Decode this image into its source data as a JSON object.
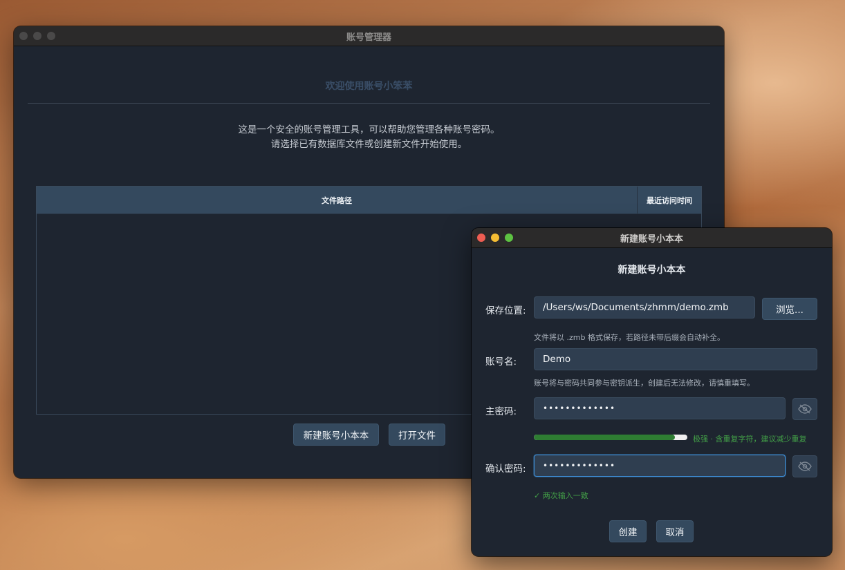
{
  "main_window": {
    "title": "账号管理器",
    "welcome": "欢迎使用账号小笨苯",
    "description_line1": "这是一个安全的账号管理工具，可以帮助您管理各种账号密码。",
    "description_line2": "请选择已有数据库文件或创建新文件开始使用。",
    "table": {
      "columns": [
        "文件路径",
        "最近访问时间"
      ],
      "rows": []
    },
    "buttons": {
      "new": "新建账号小本本",
      "open": "打开文件"
    }
  },
  "dialog": {
    "title": "新建账号小本本",
    "heading": "新建账号小本本",
    "save_location": {
      "label": "保存位置:",
      "value": "/Users/ws/Documents/zhmm/demo.zmb",
      "hint": "文件将以 .zmb 格式保存，若路径未带后缀会自动补全。",
      "browse_label": "浏览..."
    },
    "account_name": {
      "label": "账号名:",
      "value": "Demo",
      "hint": "账号将与密码共同参与密钥派生，创建后无法修改，请慎重填写。"
    },
    "master_password": {
      "label": "主密码:",
      "masked_value": "•••••••••••••"
    },
    "strength": {
      "fraction": 0.92,
      "text": "极强 · 含重复字符，建议减少重复",
      "color": "#2e7d32"
    },
    "confirm_password": {
      "label": "确认密码:",
      "masked_value": "•••••••••••••"
    },
    "match_text": "✓ 两次输入一致",
    "buttons": {
      "create": "创建",
      "cancel": "取消"
    }
  },
  "colors": {
    "window_bg": "#1e2530",
    "accent": "#34495e",
    "success": "#43a047",
    "focus": "#3f8fd8"
  }
}
